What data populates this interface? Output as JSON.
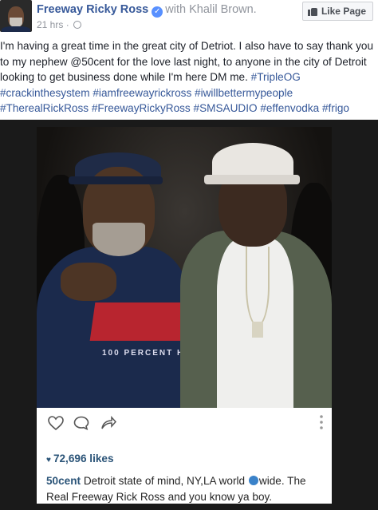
{
  "header": {
    "page_name": "Freeway Ricky Ross",
    "with_label": "with",
    "tagged_name": "Khalil Brown.",
    "timestamp": "21 hrs",
    "time_separator": "·",
    "like_page_label": "Like Page"
  },
  "post": {
    "text_plain": "I'm having a great time in the great city of Detriot. I also have to say thank you to my nephew @50cent for the love last night, to anyone in the city of Detroit looking to get business done while I'm here DM me. ",
    "hashtags": [
      "#TripleOG",
      "#crackinthesystem",
      "#iamfreewayrickross",
      "#iwillbettermypeople",
      "#TherealRickRoss",
      "#FreewayRickyRoss",
      "#SMSAUDIO",
      "#effenvodka",
      "#frigo"
    ]
  },
  "instagram": {
    "shirt_text": "100 PERCENT HUST",
    "likes": "72,696 likes",
    "caption_user": "50cent",
    "caption_before_globe": " Detroit state of mind, NY,LA world ",
    "caption_after_globe": "wide. The Real Freeway Rick Ross and you know ya boy."
  },
  "colors": {
    "facebook_link": "#365899",
    "instagram_link": "#2b5478",
    "muted": "#90949c"
  }
}
